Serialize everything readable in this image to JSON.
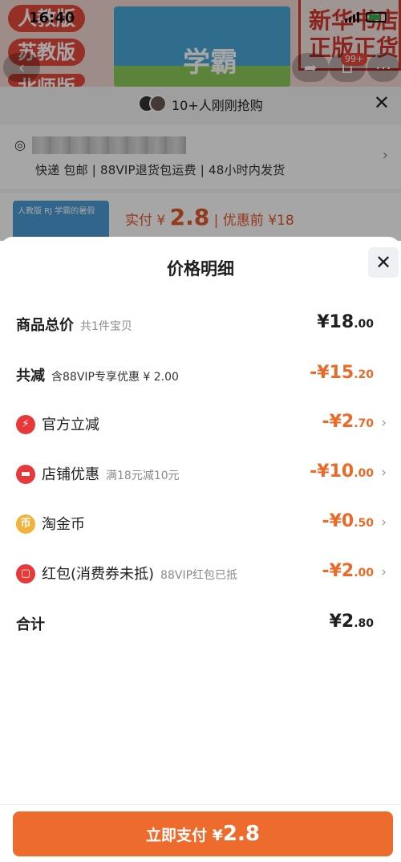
{
  "status_bar": {
    "time": "16:40"
  },
  "background": {
    "tags": [
      "人教版",
      "苏教版",
      "北师版"
    ],
    "cover_title": "学霸",
    "stamp": [
      "新华书店",
      "正版正货"
    ],
    "badge": "99+",
    "buyers_text": "10+人刚刚抢购",
    "shipping_info": "快递 包邮 | 88VIP退货包运费 | 48小时内发货",
    "thumb_text": "人教版 RJ  学霸的暑假",
    "price_prefix": "实付 ¥",
    "price_value": "2.8",
    "price_suffix": "| 优惠前 ¥18"
  },
  "sheet": {
    "title": "价格明细",
    "rows": [
      {
        "label": "商品总价",
        "sub": "共1件宝贝",
        "amount_big": "¥18",
        "amount_small": ".00",
        "icon": ""
      },
      {
        "label": "共减",
        "sub": "含88VIP专享优惠 ¥ 2.00",
        "amount_big": "-¥15",
        "amount_small": ".20",
        "icon": ""
      },
      {
        "label": "官方立减",
        "sub": "",
        "amount_big": "-¥2",
        "amount_small": ".70",
        "icon": "lightning-icon"
      },
      {
        "label": "店铺优惠",
        "sub": "满18元减10元",
        "amount_big": "-¥10",
        "amount_small": ".00",
        "icon": "shop-icon"
      },
      {
        "label": "淘金币",
        "sub": "",
        "amount_big": "-¥0",
        "amount_small": ".50",
        "icon": "coin-icon"
      },
      {
        "label": "红包(消费券未抵)",
        "sub": "88VIP红包已抵",
        "amount_big": "-¥2",
        "amount_small": ".00",
        "icon": "red-packet-icon"
      },
      {
        "label": "合计",
        "sub": "",
        "amount_big": "¥2",
        "amount_small": ".80",
        "icon": ""
      }
    ]
  },
  "pay_button": {
    "label": "立即支付 ¥",
    "amount": "2.8"
  },
  "colors": {
    "accent": "#ed6c2d",
    "discount": "#ea6b28",
    "icon_red": "#e8393a",
    "icon_gold": "#f2b33a"
  }
}
